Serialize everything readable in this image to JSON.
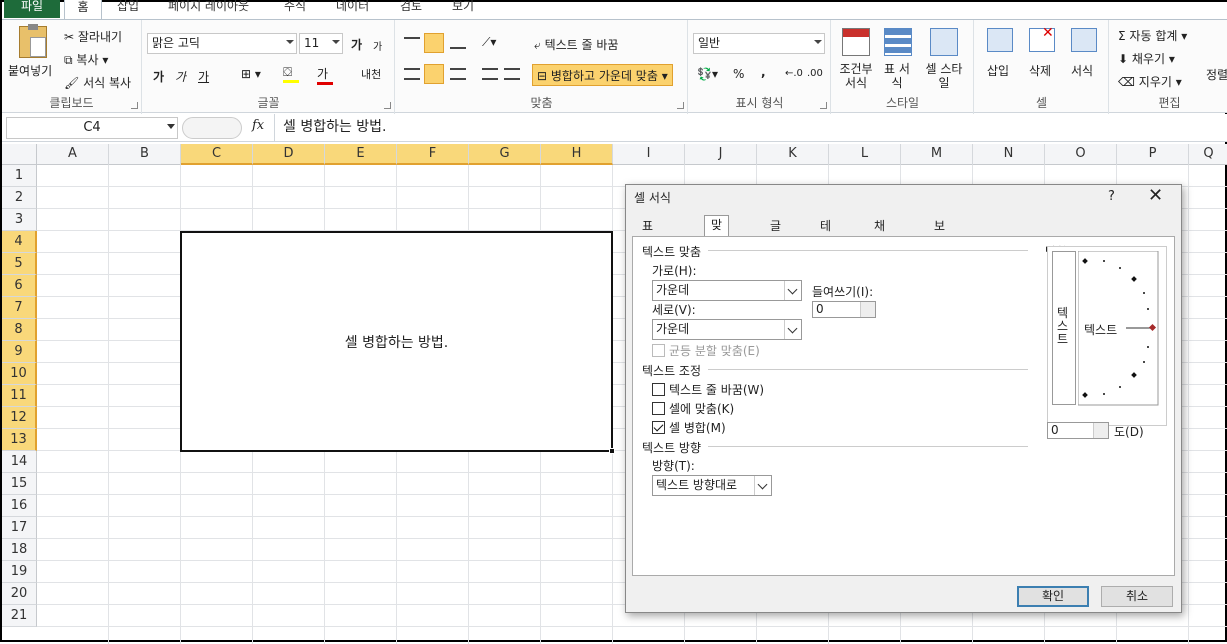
{
  "tabs": [
    "파일",
    "홈",
    "삽입",
    "페이지 레이아웃",
    "수식",
    "데이터",
    "검토",
    "보기"
  ],
  "ribbon": {
    "clipboard": {
      "label": "클립보드",
      "paste": "붙여넣기",
      "cut": "잘라내기",
      "copy": "복사",
      "format_painter": "서식 복사"
    },
    "font": {
      "label": "글꼴",
      "name": "맑은 고딕",
      "size": "11",
      "grow": "가",
      "shrink": "가",
      "bold": "가",
      "italic": "가",
      "underline": "가",
      "fill_color": "#ffff00",
      "font_color": "#e00000",
      "phonetic": "내천"
    },
    "alignment": {
      "label": "맞춤",
      "wrap": "텍스트 줄 바꿈",
      "merge": "병합하고 가운데 맞춤"
    },
    "number": {
      "label": "표시 형식",
      "format": "일반",
      "percent": "%",
      "comma": ","
    },
    "styles": {
      "label": "스타일",
      "cond": "조건부 서식",
      "table": "표 서식",
      "cell": "셀 스타일"
    },
    "cells": {
      "label": "셀",
      "insert": "삽입",
      "delete": "삭제",
      "format": "서식"
    },
    "editing": {
      "label": "편집",
      "autosum": "자동 합계",
      "fill": "채우기",
      "clear": "지우기",
      "sort": "정렬 필터"
    }
  },
  "formula_bar": {
    "name_box": "C4",
    "fx": "fx",
    "content": "셀 병합하는 방법."
  },
  "columns": [
    "A",
    "B",
    "C",
    "D",
    "E",
    "F",
    "G",
    "H",
    "I",
    "J",
    "K",
    "L",
    "M",
    "N",
    "O",
    "P",
    "Q"
  ],
  "rows": [
    "1",
    "2",
    "3",
    "4",
    "5",
    "6",
    "7",
    "8",
    "9",
    "10",
    "11",
    "12",
    "13",
    "14",
    "15",
    "16",
    "17",
    "18",
    "19",
    "20",
    "21"
  ],
  "merged_cell": {
    "text": "셀 병합하는 방법."
  },
  "dialog": {
    "title": "셀 서식",
    "help": "?",
    "close": "✕",
    "tabs": [
      "표시 형식",
      "맞춤",
      "글꼴",
      "테두리",
      "채우기",
      "보호"
    ],
    "text_align": "텍스트 맞춤",
    "horizontal": "가로(H):",
    "horizontal_value": "가운데",
    "indent": "들여쓰기(I):",
    "indent_value": "0",
    "vertical": "세로(V):",
    "vertical_value": "가운데",
    "justify": "균등 분할 맞춤(E)",
    "text_control": "텍스트 조정",
    "wrap": "텍스트 줄 바꿈(W)",
    "shrink": "셀에 맞춤(K)",
    "merge": "셀 병합(M)",
    "direction_sec": "텍스트 방향",
    "direction": "방향(T):",
    "direction_value": "텍스트 방향대로",
    "orientation": "방향",
    "vertical_text": "텍스트",
    "orient_text": "텍스트",
    "degree_value": "0",
    "degree": "도(D)",
    "ok": "확인",
    "cancel": "취소"
  }
}
